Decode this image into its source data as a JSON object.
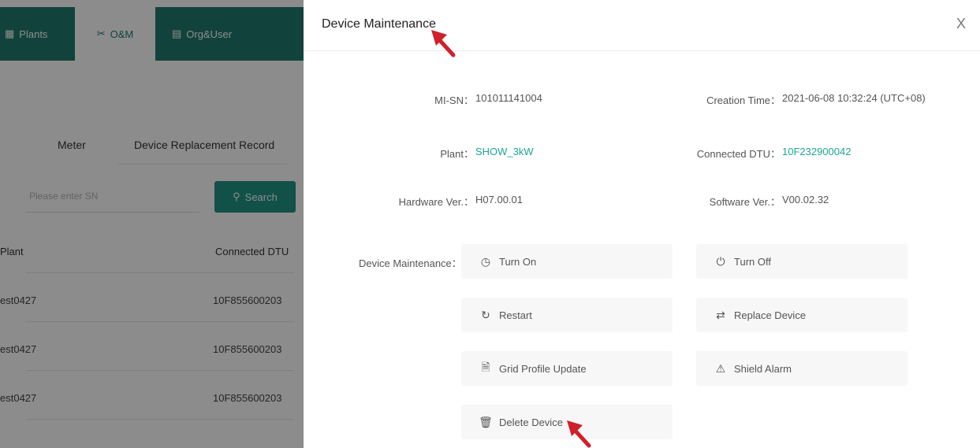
{
  "topnav": {
    "tabs": [
      {
        "label": "Plants",
        "icon": "plants-icon"
      },
      {
        "label": "O&M",
        "icon": "tools-icon"
      },
      {
        "label": "Org&User",
        "icon": "org-icon"
      }
    ],
    "active_tab": "O&M"
  },
  "subtabs": {
    "meter": "Meter",
    "replacement": "Device Replacement Record"
  },
  "search": {
    "placeholder": "Please enter SN",
    "button_label": "Search"
  },
  "table": {
    "headers": {
      "plant": "Plant",
      "dtu": "Connected DTU"
    },
    "rows": [
      {
        "plant": "est0427",
        "dtu": "10F855600203"
      },
      {
        "plant": "est0427",
        "dtu": "10F855600203"
      },
      {
        "plant": "est0427",
        "dtu": "10F855600203"
      }
    ]
  },
  "drawer": {
    "title": "Device Maintenance",
    "close_label": "X",
    "info": {
      "mi_sn_label": "MI-SN：",
      "mi_sn_value": "101011141004",
      "creation_label": "Creation Time：",
      "creation_value": "2021-06-08 10:32:24 (UTC+08)",
      "plant_label": "Plant：",
      "plant_value": "SHOW_3kW",
      "dtu_label": "Connected DTU：",
      "dtu_value": "10F232900042",
      "hw_label": "Hardware Ver.：",
      "hw_value": "H07.00.01",
      "sw_label": "Software Ver.：",
      "sw_value": "V00.02.32"
    },
    "maintenance_label": "Device Maintenance：",
    "actions": {
      "turn_on": "Turn On",
      "turn_off": "Turn Off",
      "restart": "Restart",
      "replace": "Replace Device",
      "grid_profile": "Grid Profile Update",
      "shield_alarm": "Shield Alarm",
      "delete": "Delete Device"
    }
  },
  "colors": {
    "brand": "#1f7a6d",
    "button": "#1f9484",
    "link": "#1ea592",
    "annotation_arrow": "#d0202a"
  }
}
